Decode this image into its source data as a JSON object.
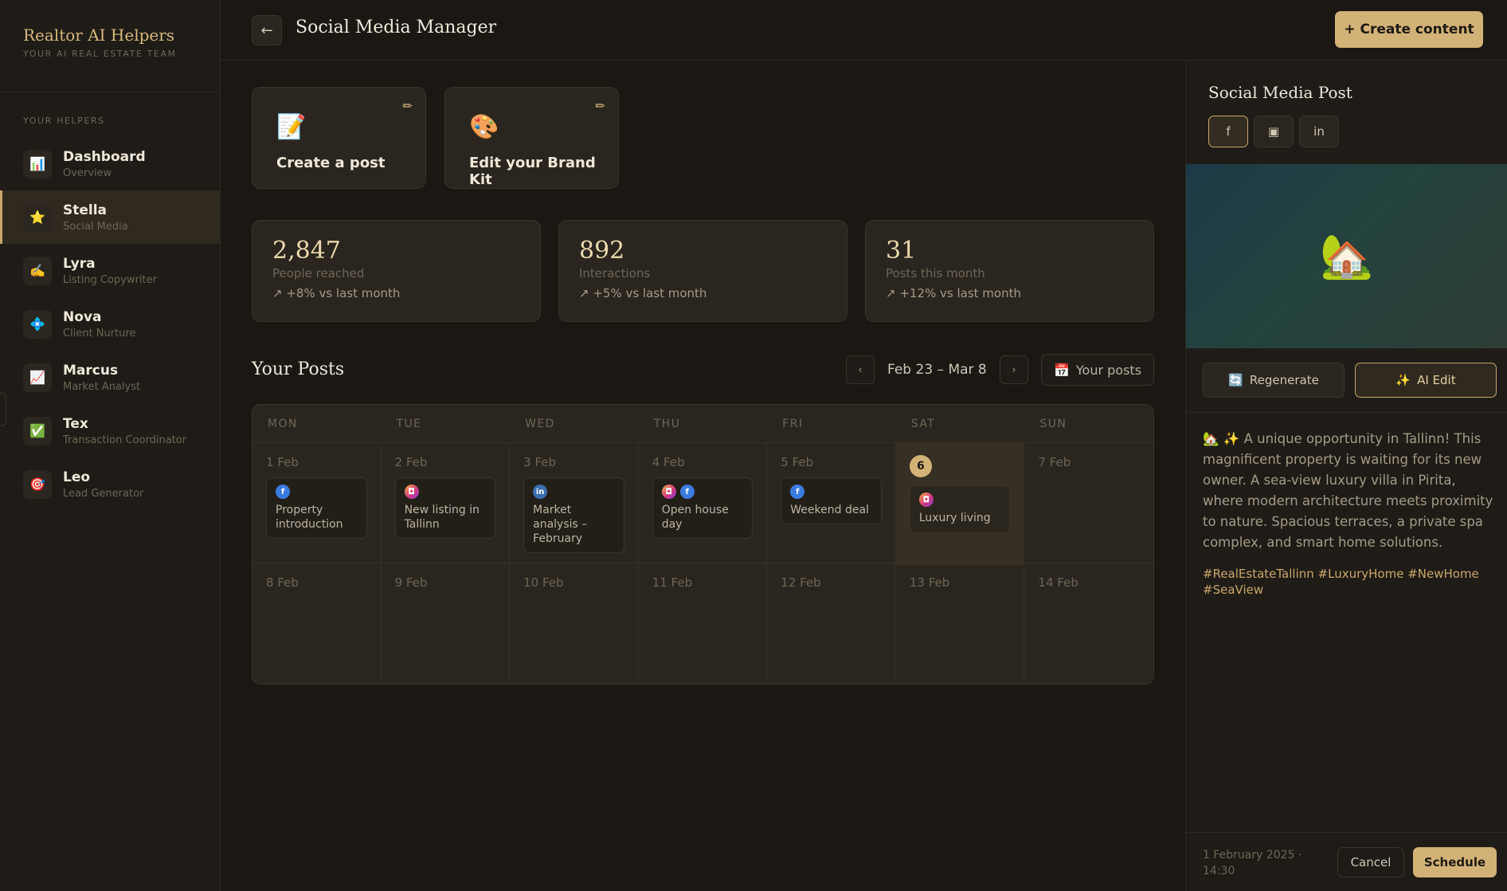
{
  "brand": {
    "title": "Realtor AI Helpers",
    "subtitle": "YOUR AI REAL ESTATE TEAM"
  },
  "sidebar": {
    "section_label": "YOUR HELPERS",
    "items": [
      {
        "name": "Dashboard",
        "role": "Overview",
        "icon": "📊"
      },
      {
        "name": "Stella",
        "role": "Social Media",
        "icon": "⭐"
      },
      {
        "name": "Lyra",
        "role": "Listing Copywriter",
        "icon": "✍️"
      },
      {
        "name": "Nova",
        "role": "Client Nurture",
        "icon": "💠"
      },
      {
        "name": "Marcus",
        "role": "Market Analyst",
        "icon": "📈"
      },
      {
        "name": "Tex",
        "role": "Transaction Coordinator",
        "icon": "✅"
      },
      {
        "name": "Leo",
        "role": "Lead Generator",
        "icon": "🎯"
      }
    ]
  },
  "header": {
    "back_icon": "←",
    "title": "Social Media Manager",
    "create_label": "+ Create content"
  },
  "actions": [
    {
      "label": "Create a post",
      "icon": "📝",
      "edit_icon": "✏"
    },
    {
      "label": "Edit your Brand Kit",
      "icon": "🎨",
      "edit_icon": "✏"
    }
  ],
  "stats": [
    {
      "value": "2,847",
      "label": "People reached",
      "trend": "↗ +8% vs last month"
    },
    {
      "value": "892",
      "label": "Interactions",
      "trend": "↗ +5% vs last month"
    },
    {
      "value": "31",
      "label": "Posts this month",
      "trend": "↗ +12% vs last month"
    }
  ],
  "posts": {
    "title": "Your Posts",
    "prev_icon": "‹",
    "next_icon": "›",
    "date_range": "Feb 23 – Mar 8",
    "filter_icon": "📅",
    "filter_label": "Your posts"
  },
  "calendar": {
    "days": [
      "MON",
      "TUE",
      "WED",
      "THU",
      "FRI",
      "SAT",
      "SUN"
    ],
    "week1": [
      {
        "date": "1 Feb",
        "post": "Property introduction",
        "icons": [
          "fb"
        ]
      },
      {
        "date": "2 Feb",
        "post": "New listing in Tallinn",
        "icons": [
          "ig"
        ]
      },
      {
        "date": "3 Feb",
        "post": "Market analysis – February",
        "icons": [
          "li"
        ]
      },
      {
        "date": "4 Feb",
        "post": "Open house day",
        "icons": [
          "ig",
          "fb"
        ]
      },
      {
        "date": "5 Feb",
        "post": "Weekend deal",
        "icons": [
          "fb"
        ]
      },
      {
        "date": "6",
        "post": "Luxury living",
        "icons": [
          "ig"
        ],
        "today": true
      },
      {
        "date": "7 Feb"
      }
    ],
    "week2": [
      "8 Feb",
      "9 Feb",
      "10 Feb",
      "11 Feb",
      "12 Feb",
      "13 Feb",
      "14 Feb"
    ],
    "icon_glyphs": {
      "fb": "f",
      "ig": "◘",
      "li": "in"
    }
  },
  "panel": {
    "title": "Social Media Post",
    "platforms": [
      {
        "name": "facebook",
        "glyph": "f"
      },
      {
        "name": "instagram",
        "glyph": "▣"
      },
      {
        "name": "linkedin",
        "glyph": "in"
      }
    ],
    "preview_icon": "🏡",
    "regenerate_icon": "🔄",
    "regenerate_label": "Regenerate",
    "ai_edit_icon": "✨",
    "ai_edit_label": "AI Edit",
    "post_text": "🏡 ✨ A unique opportunity in Tallinn! This magnificent property is waiting for its new owner. A sea-view luxury villa in Pirita, where modern architecture meets proximity to nature. Spacious terraces, a private spa complex, and smart home solutions.",
    "hashtags": "#RealEstateTallinn #LuxuryHome #NewHome #SeaView",
    "schedule_time": "1 February 2025 · 14:30",
    "cancel_label": "Cancel",
    "schedule_label": "Schedule"
  },
  "colors": {
    "accent": "#d3b277",
    "background": "#1b1813",
    "card": "#2a261f"
  }
}
